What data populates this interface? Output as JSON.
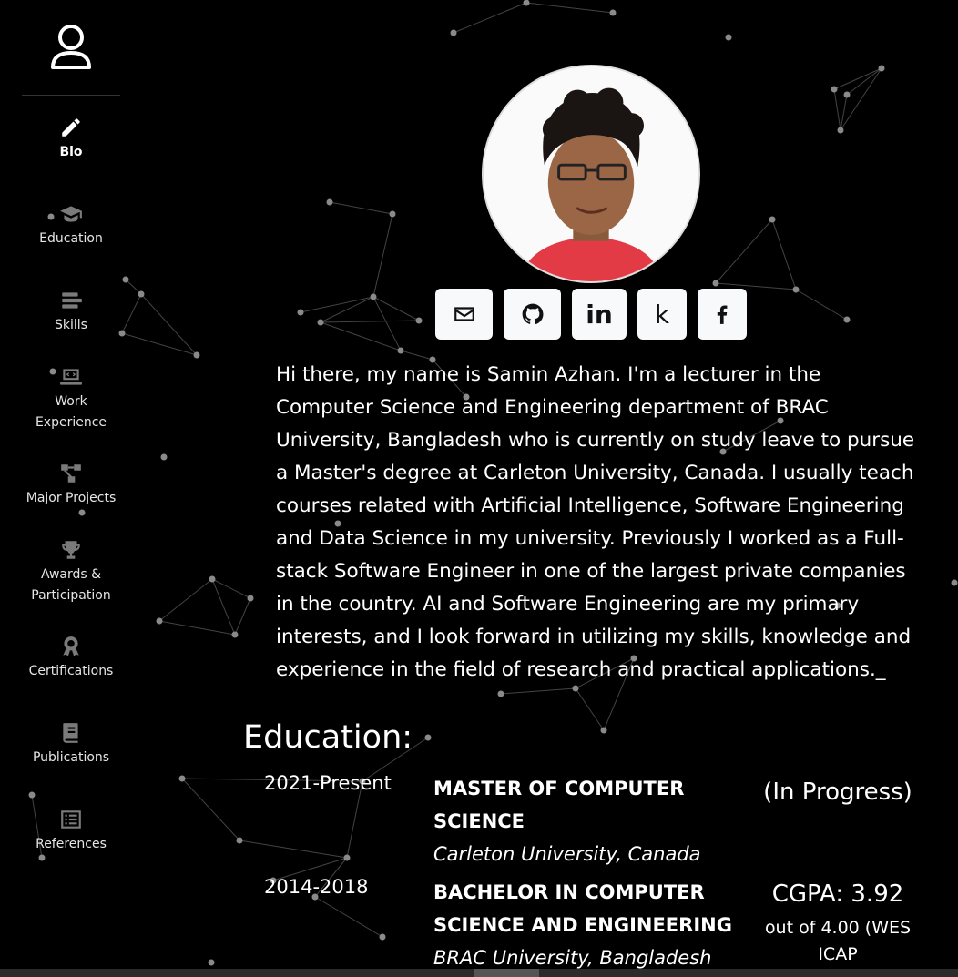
{
  "sidebar": {
    "items": [
      {
        "label": "Bio",
        "icon": "pencil-icon",
        "active": true
      },
      {
        "label": "Education",
        "icon": "graduation-cap-icon"
      },
      {
        "label": "Skills",
        "icon": "bars-icon"
      },
      {
        "label": "Work\nExperience",
        "icon": "laptop-code-icon"
      },
      {
        "label": "Major Projects",
        "icon": "project-diagram-icon"
      },
      {
        "label": "Awards &\nParticipation",
        "icon": "trophy-icon"
      },
      {
        "label": "Certifications",
        "icon": "award-icon"
      },
      {
        "label": "Publications",
        "icon": "book-icon"
      },
      {
        "label": "References",
        "icon": "list-alt-icon"
      }
    ]
  },
  "profile": {
    "social": [
      {
        "name": "email",
        "icon": "envelope-icon"
      },
      {
        "name": "github",
        "icon": "github-icon"
      },
      {
        "name": "linkedin",
        "icon": "linkedin-icon",
        "glyph": "in"
      },
      {
        "name": "kaggle",
        "icon": "kaggle-icon",
        "glyph": "k"
      },
      {
        "name": "facebook",
        "icon": "facebook-icon"
      }
    ],
    "bio": "Hi there, my name is Samin Azhan. I'm a lecturer in the Computer Science and Engineering department of BRAC University, Bangladesh who is currently on study leave to pursue a Master's degree at Carleton University, Canada. I usually teach courses related with Artificial Intelligence, Software Engineering and Data Science in my university. Previously I worked as a Full-stack Software Engineer in one of the largest private companies in the country. AI and Software Engineering are my primary interests, and I look forward in utilizing my skills, knowledge and experience in the field of research and practical applications._"
  },
  "education": {
    "title": "Education:",
    "rows": [
      {
        "years": "2021-Present",
        "degree": "MASTER OF COMPUTER SCIENCE",
        "institution": "Carleton University, Canada",
        "result": "(In Progress)",
        "result_sub": ""
      },
      {
        "years": "2014-2018",
        "degree": "BACHELOR IN COMPUTER SCIENCE AND ENGINEERING",
        "institution": "BRAC University, Bangladesh",
        "result": "CGPA: 3.92",
        "result_sub": "out of 4.00 (WES ICAP"
      }
    ]
  },
  "colors": {
    "background": "#000000",
    "text": "#ffffff",
    "button": "#f8f9fa",
    "network": "#8a8a8a"
  }
}
